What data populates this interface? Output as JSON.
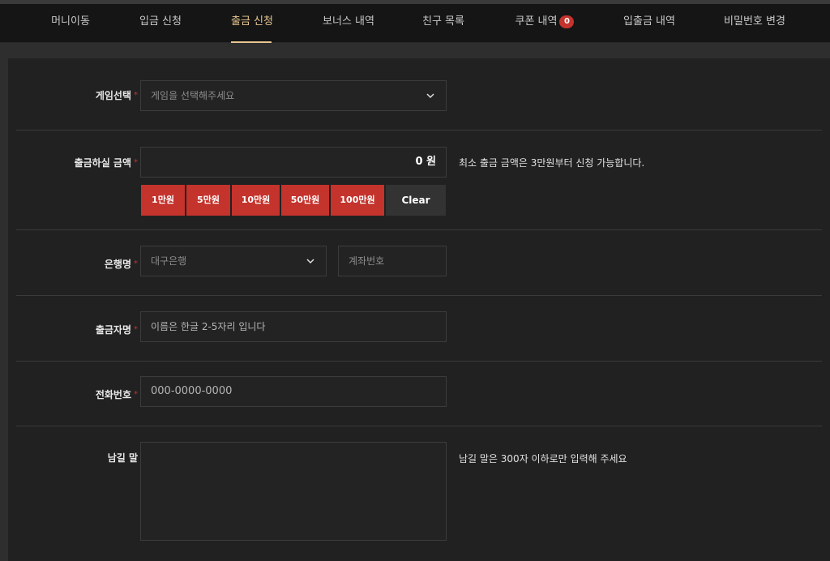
{
  "nav": {
    "tabs": [
      {
        "label": "머니이동"
      },
      {
        "label": "입금 신청"
      },
      {
        "label": "출금 신청"
      },
      {
        "label": "보너스 내역"
      },
      {
        "label": "친구 목록"
      },
      {
        "label": "쿠폰 내역",
        "badge": "0"
      },
      {
        "label": "입출금 내역"
      },
      {
        "label": "비밀번호 변경"
      }
    ],
    "active_index": 2
  },
  "form": {
    "game": {
      "label": "게임선택",
      "required_mark": "*",
      "placeholder": "게임을 선택해주세요"
    },
    "amount": {
      "label": "출금하실 금액",
      "required_mark": "*",
      "value": "0 원",
      "hint": "최소 출금 금액은 3만원부터 신청 가능합니다.",
      "buttons": [
        "1만원",
        "5만원",
        "10만원",
        "50만원",
        "100만원"
      ],
      "clear_label": "Clear"
    },
    "bank": {
      "label": "은행명",
      "required_mark": "*",
      "selected": "대구은행",
      "account_placeholder": "계좌번호"
    },
    "depositor": {
      "label": "출금자명",
      "required_mark": "*",
      "placeholder": "이름은 한글 2-5자리 입니다"
    },
    "phone": {
      "label": "전화번호",
      "required_mark": "*",
      "placeholder": "000-0000-0000"
    },
    "memo": {
      "label": "남길 말",
      "hint": "남길 말은 300자 이하로만 입력해 주세요"
    }
  },
  "colors": {
    "accent_gold": "#e7c690",
    "accent_red": "#c4332c",
    "background": "#212121"
  }
}
